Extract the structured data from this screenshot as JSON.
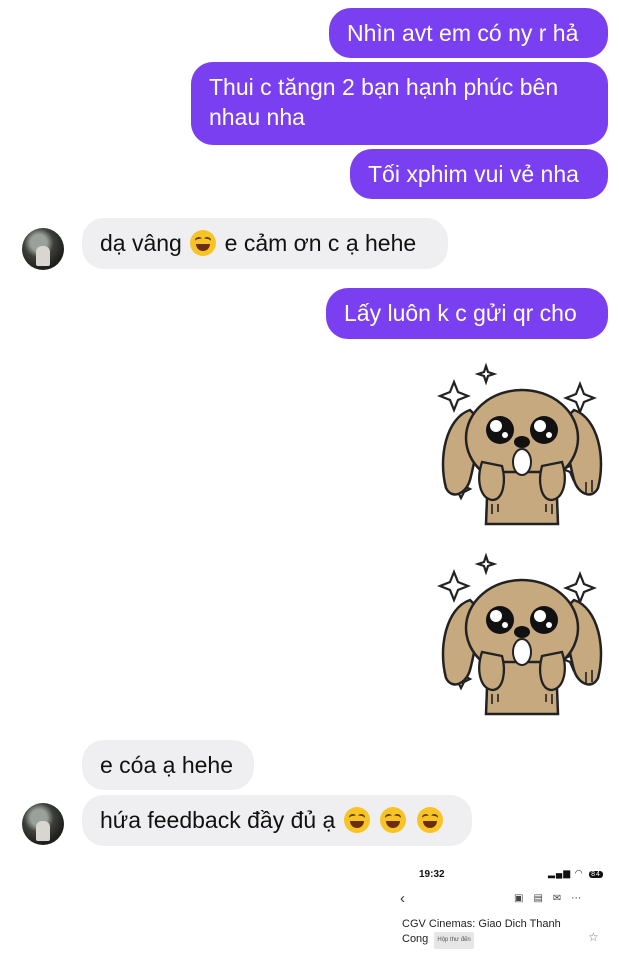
{
  "messages": {
    "out1": "Nhìn avt em có ny r hả",
    "out2_line1": "Thui c tăngn 2 bạn hạnh phúc bên",
    "out2_line2": "nhau nha",
    "out3": "Tối xphim vui vẻ nha",
    "in1_before": "dạ vâng",
    "in1_after": "e cảm ơn c ạ hehe",
    "out4": "Lấy luôn k c gửi qr cho",
    "in2": "e cóa ạ hehe",
    "in3": "hứa feedback đầy đủ ạ"
  },
  "icons": {
    "laugh_emoji": "rolling-on-floor-laughing-emoji",
    "sticker": "puppy-sparkle-sticker"
  },
  "colors": {
    "outgoing_bubble": "#7b3ff2",
    "incoming_bubble": "#efeff1"
  },
  "email_preview": {
    "time": "19:32",
    "battery": "84",
    "back": "‹",
    "subject_line1": "CGV Cinemas: Giao Dich Thanh",
    "subject_line2": "Cong",
    "label": "Hộp thư đến",
    "star": "☆"
  }
}
